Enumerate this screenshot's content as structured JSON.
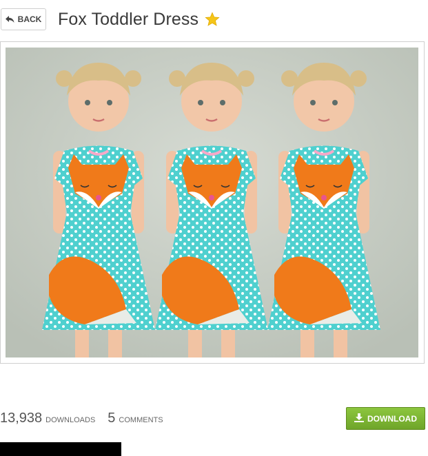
{
  "header": {
    "back_label": "BACK",
    "title": "Fox Toddler Dress"
  },
  "icons": {
    "back": "reply-arrow-icon",
    "featured": "star-icon",
    "download": "download-icon"
  },
  "preview": {
    "figure_count": 3,
    "dress_color": "#4fd0cf",
    "fox_color": "#f07a1a",
    "background_color": "#c6ccc3"
  },
  "stats": {
    "downloads_count": "13,938",
    "downloads_label": "DOWNLOADS",
    "comments_count": "5",
    "comments_label": "COMMENTS"
  },
  "download_button": {
    "label": "DOWNLOAD",
    "color": "#7cb835"
  },
  "colors": {
    "star": "#f5c518"
  }
}
